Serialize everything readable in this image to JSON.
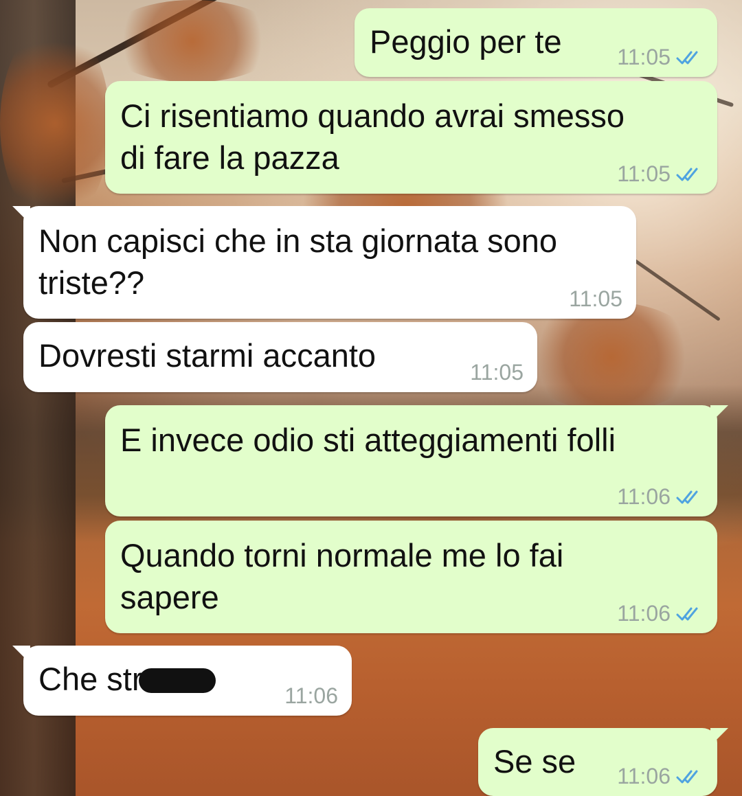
{
  "chat": {
    "messages": [
      {
        "direction": "out",
        "text": "Peggio per te",
        "time": "11:05",
        "status_icon": "double-check-icon"
      },
      {
        "direction": "out",
        "text": "Ci risentiamo quando avrai smesso\ndi fare la pazza",
        "time": "11:05",
        "status_icon": "double-check-icon"
      },
      {
        "direction": "in",
        "text": "Non capisci che in sta giornata sono\ntriste??",
        "time": "11:05"
      },
      {
        "direction": "in",
        "text": "Dovresti starmi accanto",
        "time": "11:05"
      },
      {
        "direction": "out",
        "text": "E invece odio sti atteggiamenti folli",
        "time": "11:06",
        "status_icon": "double-check-icon"
      },
      {
        "direction": "out",
        "text": "Quando torni normale me lo fai\nsapere",
        "time": "11:06",
        "status_icon": "double-check-icon"
      },
      {
        "direction": "in",
        "text": "Che str",
        "time": "11:06",
        "redacted": true
      },
      {
        "direction": "out",
        "text": "Se se",
        "time": "11:06",
        "status_icon": "double-check-icon"
      }
    ]
  },
  "colors": {
    "outgoing_bubble": "#e2fecb",
    "incoming_bubble": "#ffffff",
    "read_tick": "#4fa3e0",
    "timestamp": "#9aa5a0"
  }
}
